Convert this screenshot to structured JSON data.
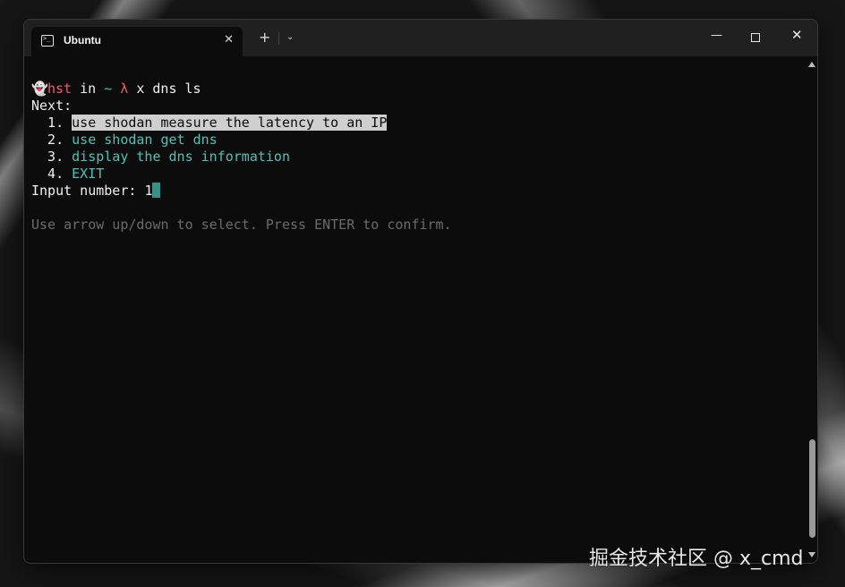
{
  "window": {
    "tab_title": "Ubuntu",
    "tab_close": "✕",
    "new_tab": "+",
    "tab_dropdown": "⌄",
    "minimize": "—",
    "close": "✕"
  },
  "terminal": {
    "prompt": {
      "icon": "ghost-icon",
      "user": "hst",
      "in_word": " in ",
      "dir": "~",
      "lambda": " λ",
      "command": " x dns ls"
    },
    "next_label": "Next:",
    "options": [
      {
        "num": "  1. ",
        "label": "use shodan measure the latency to an IP",
        "selected": true
      },
      {
        "num": "  2. ",
        "label": "use shodan get dns",
        "selected": false
      },
      {
        "num": "  3. ",
        "label": "display the dns information",
        "selected": false
      },
      {
        "num": "  4. ",
        "label": "EXIT",
        "selected": false
      }
    ],
    "input_label": "Input number: ",
    "input_value": "1",
    "hint": "Use arrow up/down to select. Press ENTER to confirm."
  },
  "watermark": "掘金技术社区 @ x_cmd",
  "colors": {
    "prompt_user": "#e85d75",
    "prompt_dir": "#5ab4b0",
    "option": "#4fc1b6",
    "selection_bg": "#cfcfcf",
    "cursor": "#3b8f86",
    "hint": "#6b6b6b"
  }
}
